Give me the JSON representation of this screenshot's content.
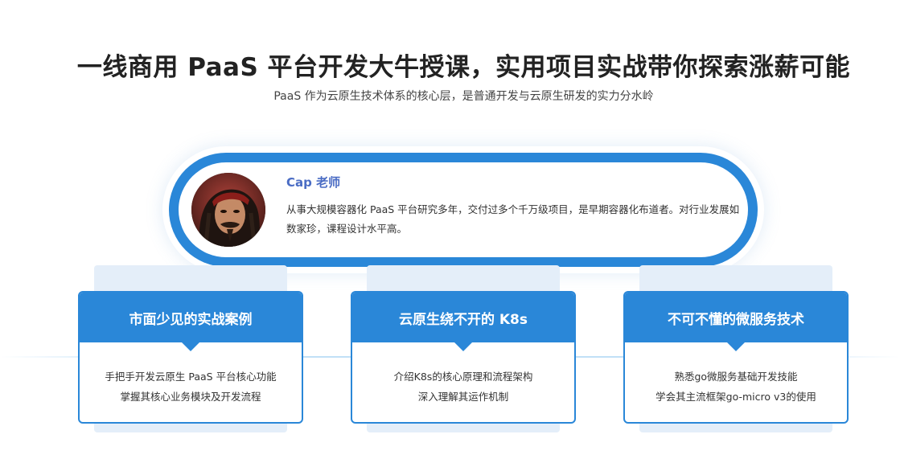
{
  "header": {
    "title": "一线商用 PaaS 平台开发大牛授课，实用项目实战带你探索涨薪可能",
    "subtitle": "PaaS 作为云原生技术体系的核心层，是普通开发与云原生研发的实力分水岭"
  },
  "teacher": {
    "name": "Cap 老师",
    "description": "从事大规模容器化 PaaS 平台研究多年，交付过多个千万级项目，是早期容器化布道者。对行业发展如数家珍，课程设计水平高。"
  },
  "cards": [
    {
      "title": "市面少见的实战案例",
      "lines": [
        "手把手开发云原生 PaaS 平台核心功能",
        "掌握其核心业务模块及开发流程"
      ]
    },
    {
      "title": "云原生绕不开的 K8s",
      "lines": [
        "介绍K8s的核心原理和流程架构",
        "深入理解其运作机制"
      ]
    },
    {
      "title": "不可不懂的微服务技术",
      "lines": [
        "熟悉go微服务基础开发技能",
        "学会其主流框架go-micro v3的使用"
      ]
    }
  ],
  "colors": {
    "accent": "#2a87d8",
    "card_bg": "#e4eef9",
    "teacher_name": "#4a6cc4"
  }
}
